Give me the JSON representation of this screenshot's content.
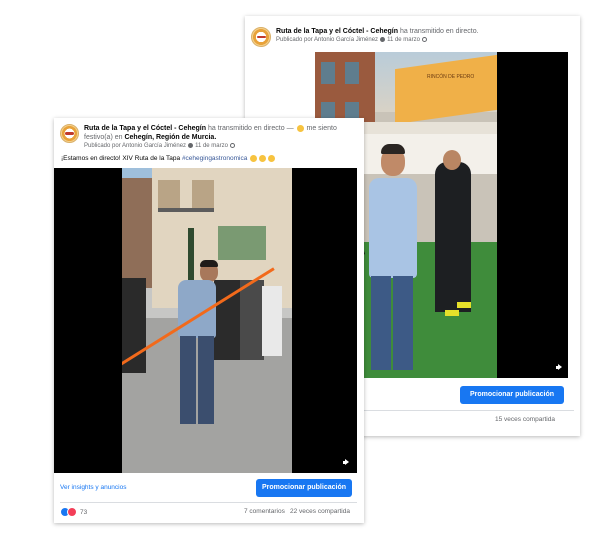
{
  "back_post": {
    "page_name": "Ruta de la Tapa y el Cóctel - Cehegín",
    "action": "ha transmitido en directo.",
    "published_by": "Publicado por Antonio García Jiménez",
    "date": "11 de marzo",
    "shop_sign": "RINCÓN DE PEDRO",
    "promote_button": "Promocionar publicación",
    "shares": "15 veces compartida"
  },
  "front_post": {
    "page_name": "Ruta de la Tapa y el Cóctel - Cehegín",
    "action": "ha transmitido en directo —",
    "feeling": "me siento festivo(a) en",
    "location": "Cehegín, Región de Murcia.",
    "published_by": "Publicado por Antonio García Jiménez",
    "date": "11 de marzo",
    "caption": "¡Estamos en directo! XIV Ruta de la Tapa",
    "hashtag": "#cehegingastronomica",
    "insights_link": "Ver insights y anuncios",
    "promote_button": "Promocionar publicación",
    "reactions_count": "73",
    "comments": "7 comentarios",
    "shares": "22 veces compartida"
  },
  "colors": {
    "facebook_blue": "#1877f2",
    "hashtag": "#385898",
    "secondary_text": "#65676b"
  },
  "icons": [
    "verified-badge-icon",
    "globe-icon",
    "volume-icon",
    "like-reaction-icon",
    "love-reaction-icon",
    "party-emoji-icon"
  ]
}
